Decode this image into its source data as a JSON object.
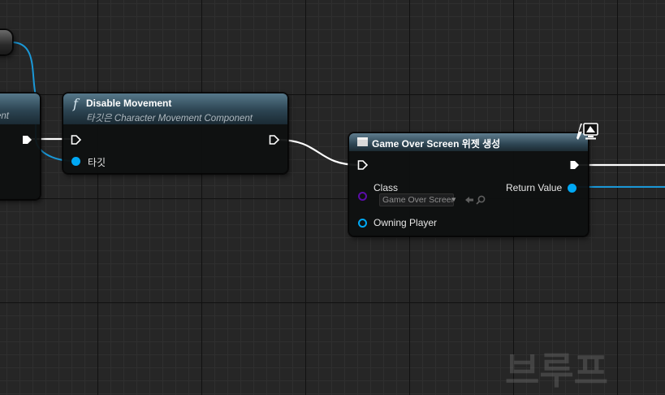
{
  "left_node": {
    "subtitle_fragment": "ent"
  },
  "disable_node": {
    "icon": "function-icon",
    "icon_glyph": "f",
    "title": "Disable Movement",
    "subtitle": "타깃은 Character Movement Component",
    "target_label": "타깃"
  },
  "widget_node": {
    "title": "Game Over Screen 위젯 생성",
    "class_label": "Class",
    "class_value": "Game Over Screen",
    "owning_label": "Owning Player",
    "return_label": "Return Value",
    "badge_icon": "client-only-icon"
  },
  "watermark": {
    "text": "브루프"
  },
  "colors": {
    "exec": "#ffffff",
    "object": "#00a8f4",
    "class": "#5b0ca8",
    "wire_object": "#1a97d6"
  }
}
